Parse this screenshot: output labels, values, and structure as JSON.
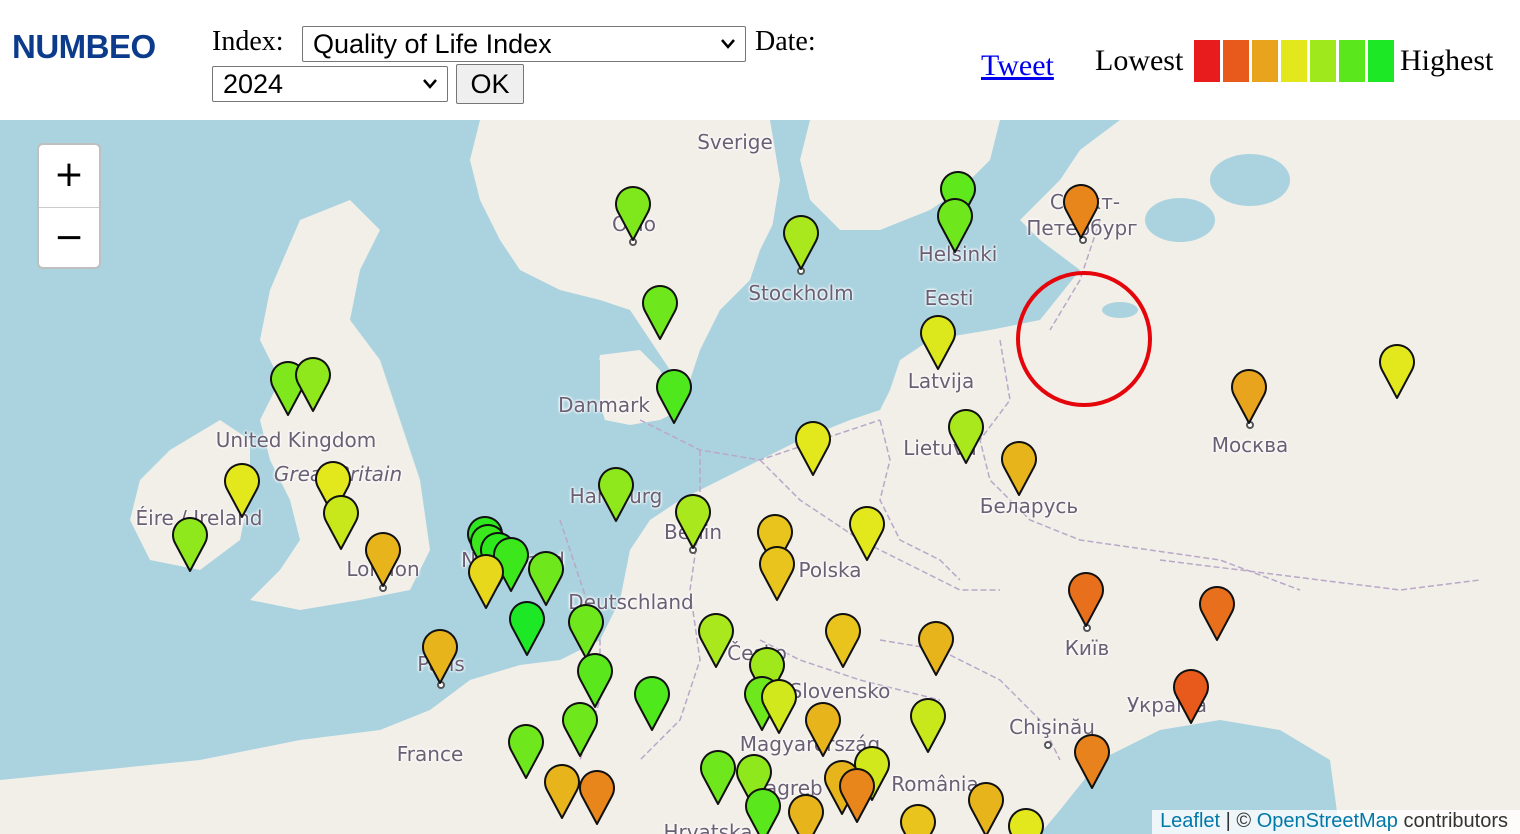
{
  "header": {
    "logo": "NUMBEO",
    "index_label": "Index:",
    "index_value": "Quality of Life Index",
    "date_label": "Date:",
    "year_value": "2024",
    "ok_label": "OK",
    "tweet_label": "Tweet",
    "legend_low": "Lowest",
    "legend_high": "Highest",
    "legend_colors": [
      "#e81c1c",
      "#e85a1c",
      "#e8a41c",
      "#e3e81c",
      "#9ee81c",
      "#5ae81c",
      "#1ce825"
    ]
  },
  "map": {
    "zoom_in": "+",
    "zoom_out": "−",
    "attribution": {
      "leaflet": "Leaflet",
      "sep": " | © ",
      "osm": "OpenStreetMap",
      "contributors": " contributors"
    },
    "labels": [
      {
        "text": "Sverige"
      },
      {
        "text": "Oslo"
      },
      {
        "text": "Stockholm"
      },
      {
        "text": "Helsinki"
      },
      {
        "text": "Санкт-"
      },
      {
        "text": "Петербург"
      },
      {
        "text": "Eesti"
      },
      {
        "text": "Latvija"
      },
      {
        "text": "Danmark"
      },
      {
        "text": "United Kingdom"
      },
      {
        "text": "Great Britain"
      },
      {
        "text": "Éire / Ireland"
      },
      {
        "text": "Lietuva"
      },
      {
        "text": "Москва"
      },
      {
        "text": "Hamburg"
      },
      {
        "text": "Berlin"
      },
      {
        "text": "Беларусь"
      },
      {
        "text": "Nederland"
      },
      {
        "text": "Polska"
      },
      {
        "text": "London"
      },
      {
        "text": "Deutschland"
      },
      {
        "text": "Київ"
      },
      {
        "text": "Česko"
      },
      {
        "text": "Paris"
      },
      {
        "text": "Slovensko"
      },
      {
        "text": "Україна"
      },
      {
        "text": "France"
      },
      {
        "text": "Chişinău"
      },
      {
        "text": "Magyarország"
      },
      {
        "text": "Zagreb"
      },
      {
        "text": "România"
      },
      {
        "text": "Hrvatska"
      }
    ],
    "markers": [
      {
        "city": "Oslo",
        "color": "#7ee81c"
      },
      {
        "city": "Stockholm",
        "color": "#a8e81c"
      },
      {
        "city": "Helsinki A",
        "color": "#5fe81c"
      },
      {
        "city": "Helsinki B",
        "color": "#6ee81c"
      },
      {
        "city": "Saint Petersburg",
        "color": "#e8861c"
      },
      {
        "city": "Gothenburg",
        "color": "#6ee81c"
      },
      {
        "city": "Tallinn/Riga",
        "color": "#dce81c"
      },
      {
        "city": "Copenhagen",
        "color": "#4fe81c"
      },
      {
        "city": "Kazan",
        "color": "#e3e81c"
      },
      {
        "city": "Moscow",
        "color": "#e8a41c"
      },
      {
        "city": "Edinburgh",
        "color": "#7ee81c"
      },
      {
        "city": "Glasgow",
        "color": "#8ee81c"
      },
      {
        "city": "Vilnius",
        "color": "#a8e81c"
      },
      {
        "city": "Minsk",
        "color": "#e8b41c"
      },
      {
        "city": "Gdansk",
        "color": "#e3e81c"
      },
      {
        "city": "Dublin",
        "color": "#e3e81c"
      },
      {
        "city": "Leeds",
        "color": "#e3e81c"
      },
      {
        "city": "Manchester",
        "color": "#c8e81c"
      },
      {
        "city": "Cork",
        "color": "#8ee81c"
      },
      {
        "city": "Hamburg",
        "color": "#8ee81c"
      },
      {
        "city": "Berlin",
        "color": "#a8e81c"
      },
      {
        "city": "Poznan",
        "color": "#e8c41c"
      },
      {
        "city": "Warsaw",
        "color": "#e3e81c"
      },
      {
        "city": "London",
        "color": "#e8b41c"
      },
      {
        "city": "Amsterdam A",
        "color": "#2ce81c"
      },
      {
        "city": "Amsterdam B",
        "color": "#3ae81c"
      },
      {
        "city": "Utrecht",
        "color": "#2ce81c"
      },
      {
        "city": "Rotterdam",
        "color": "#3ce81c"
      },
      {
        "city": "Eindhoven",
        "color": "#6ee81c"
      },
      {
        "city": "Brussels",
        "color": "#e8d81c"
      },
      {
        "city": "Wroclaw",
        "color": "#e8c41c"
      },
      {
        "city": "Kyiv",
        "color": "#e8701c"
      },
      {
        "city": "Kharkiv",
        "color": "#e8701c"
      },
      {
        "city": "Luxembourg",
        "color": "#1ce825"
      },
      {
        "city": "Frankfurt",
        "color": "#6ee81c"
      },
      {
        "city": "Leipzig",
        "color": "#a8e81c"
      },
      {
        "city": "Krakow",
        "color": "#e8c41c"
      },
      {
        "city": "Lviv",
        "color": "#e8b41c"
      },
      {
        "city": "Paris",
        "color": "#e8b41c"
      },
      {
        "city": "Stuttgart",
        "color": "#5ae81c"
      },
      {
        "city": "Prague",
        "color": "#9ee81c"
      },
      {
        "city": "Nuremberg",
        "color": "#4fe81c"
      },
      {
        "city": "Dnipro",
        "color": "#e85a1c"
      },
      {
        "city": "Brno",
        "color": "#6ee81c"
      },
      {
        "city": "Bratislava",
        "color": "#d0e81c"
      },
      {
        "city": "Munich",
        "color": "#6ee81c"
      },
      {
        "city": "Kosice",
        "color": "#e8b41c"
      },
      {
        "city": "Cluj",
        "color": "#c8e81c"
      },
      {
        "city": "Zurich",
        "color": "#6ee81c"
      },
      {
        "city": "Odesa",
        "color": "#e8821c"
      },
      {
        "city": "Vienna",
        "color": "#6ee81c"
      },
      {
        "city": "Graz",
        "color": "#8ee81c"
      },
      {
        "city": "Debrecen",
        "color": "#d0e81c"
      },
      {
        "city": "Budapest",
        "color": "#e8b41c"
      },
      {
        "city": "Lyon",
        "color": "#e8b41c"
      },
      {
        "city": "Geneva",
        "color": "#e8861c"
      },
      {
        "city": "Timisoara",
        "color": "#e8861c"
      },
      {
        "city": "Bucharest",
        "color": "#e8b41c"
      },
      {
        "city": "Zagreb",
        "color": "#5ae81c"
      },
      {
        "city": "Belgrade",
        "color": "#e8b41c"
      },
      {
        "city": "Sofia area",
        "color": "#e8c41c"
      },
      {
        "city": "Constanta",
        "color": "#e3e81c"
      }
    ]
  }
}
